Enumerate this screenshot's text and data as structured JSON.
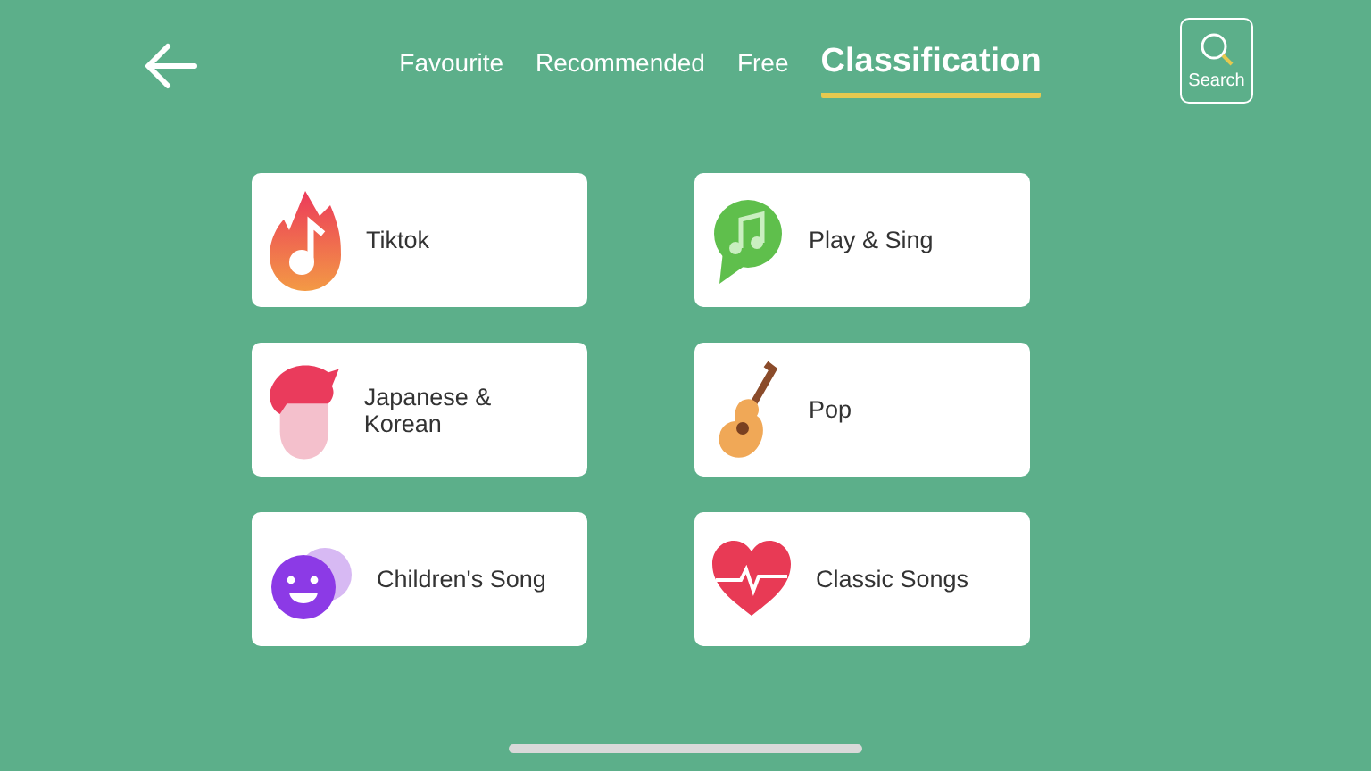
{
  "tabs": [
    {
      "label": "Favourite",
      "selected": false
    },
    {
      "label": "Recommended",
      "selected": false
    },
    {
      "label": "Free",
      "selected": false
    },
    {
      "label": "Classification",
      "selected": true
    }
  ],
  "search_button": {
    "label": "Search"
  },
  "categories": [
    {
      "label": "Tiktok",
      "kind": "flame"
    },
    {
      "label": "Play & Sing",
      "kind": "chat"
    },
    {
      "label": "Japanese & Korean",
      "kind": "hair"
    },
    {
      "label": "Pop",
      "kind": "guitar"
    },
    {
      "label": "Children's Song",
      "kind": "smiley"
    },
    {
      "label": "Classic Songs",
      "kind": "heart"
    }
  ]
}
